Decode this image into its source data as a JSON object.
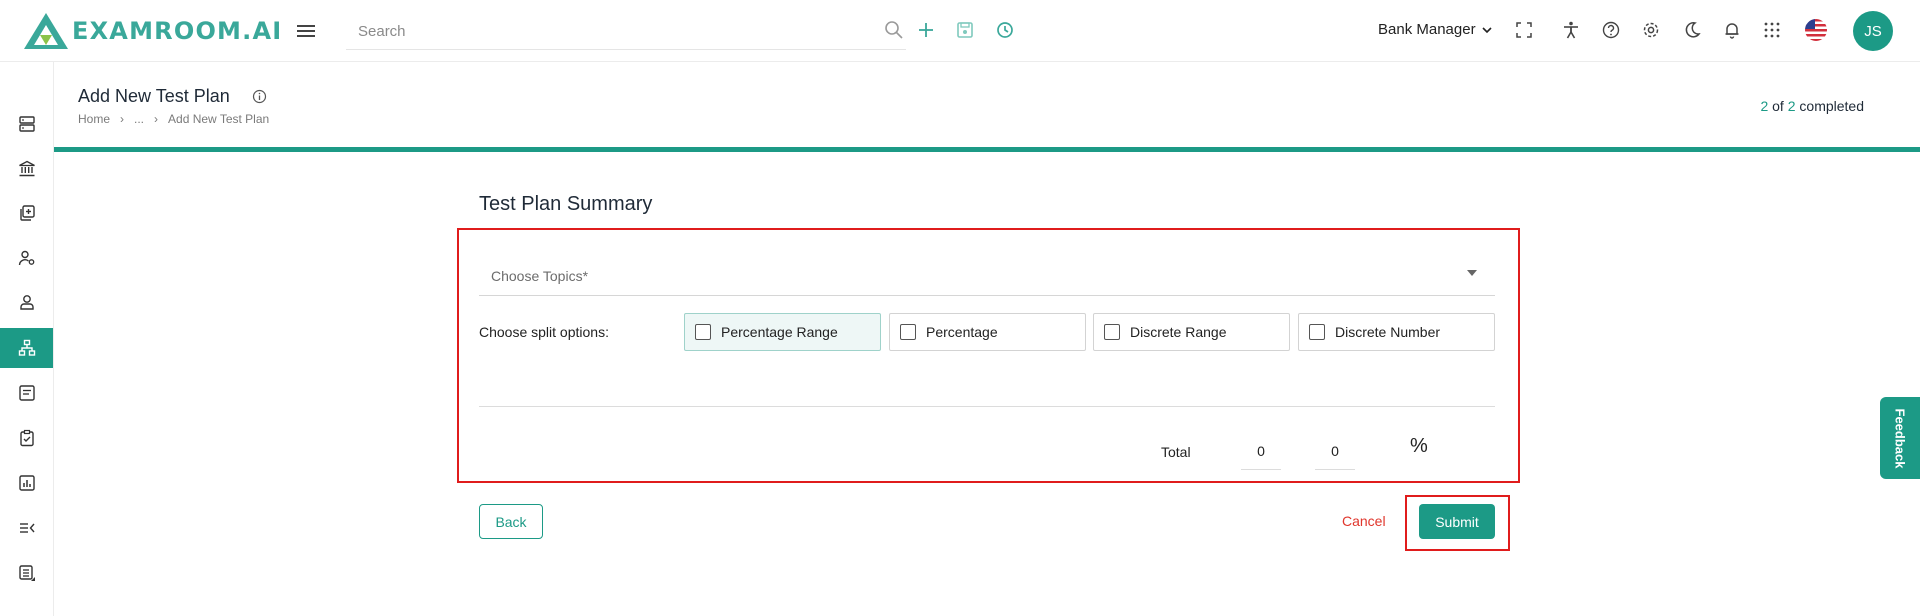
{
  "app": {
    "logo_text": "EXAMROOM.AI"
  },
  "header": {
    "search_placeholder": "Search",
    "role": "Bank Manager",
    "avatar_initials": "JS"
  },
  "page": {
    "title": "Add New Test Plan",
    "breadcrumb": [
      "Home",
      "...",
      "Add New Test Plan"
    ],
    "progress": {
      "current": "2",
      "of_label": "of",
      "total": "2",
      "suffix": "completed",
      "fraction": 1.0
    }
  },
  "form": {
    "section_title": "Test Plan Summary",
    "topics_label": "Choose Topics*",
    "split_label": "Choose split options:",
    "split_options": [
      "Percentage Range",
      "Percentage",
      "Discrete Range",
      "Discrete Number"
    ],
    "selected_option": "Percentage Range",
    "total_label": "Total",
    "total_values": [
      "0",
      "0"
    ],
    "percent_symbol": "%"
  },
  "actions": {
    "back": "Back",
    "cancel": "Cancel",
    "submit": "Submit"
  },
  "feedback": "Feedback",
  "colors": {
    "brand": "#1c9a86",
    "highlight": "#e01c1c",
    "cancel": "#e0362c"
  },
  "sidebar_icons": [
    "server-icon",
    "bank-icon",
    "add-copy-icon",
    "user-settings-icon",
    "user-icon",
    "sitemap-icon",
    "form-icon",
    "clipboard-check-icon",
    "report-chart-icon",
    "collapse-list-icon",
    "list-detail-icon"
  ],
  "toolbar_icons": [
    "search-icon",
    "plus-icon",
    "save-icon",
    "history-icon",
    "fullscreen-icon",
    "accessibility-icon",
    "help-icon",
    "gear-icon",
    "moon-icon",
    "bell-icon",
    "apps-grid-icon",
    "flag-us-icon"
  ]
}
